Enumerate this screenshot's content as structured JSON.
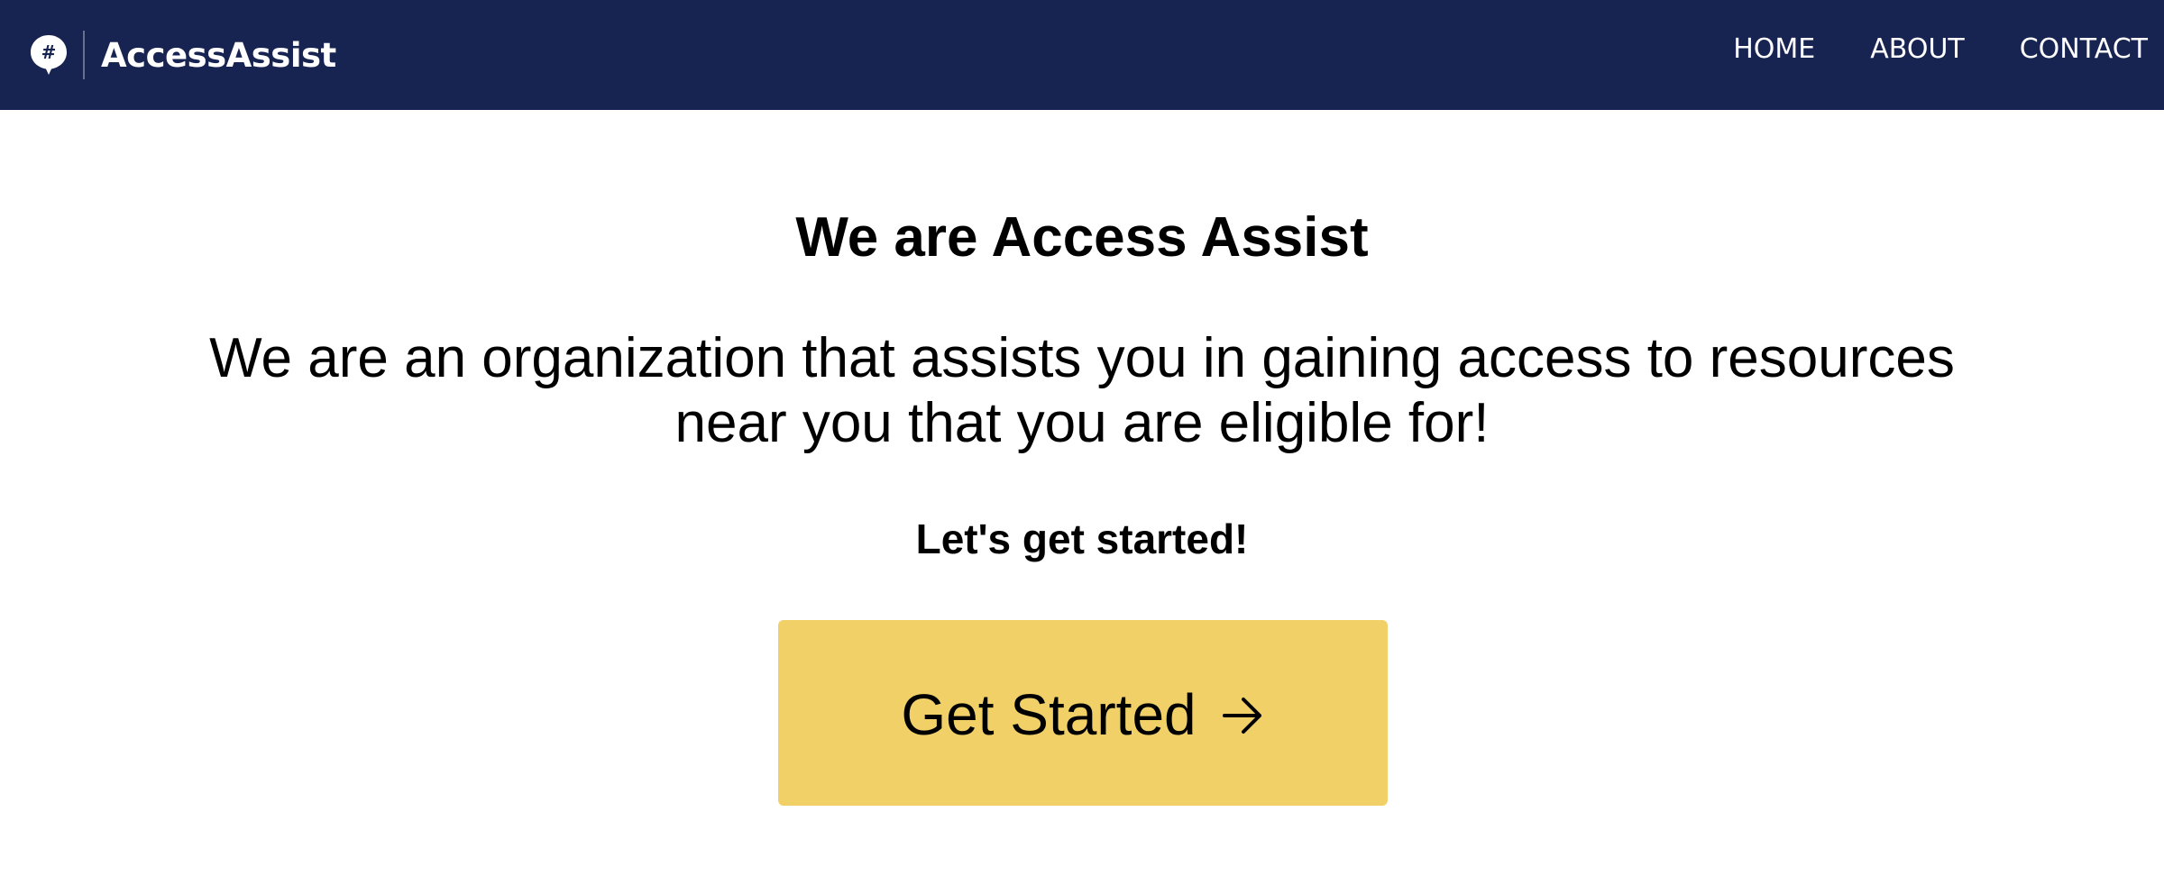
{
  "header": {
    "brand_name": "AccessAssist",
    "logo_icon": "hashtag-speech-bubble-icon",
    "logo_symbol": "#",
    "nav": [
      {
        "label": "HOME"
      },
      {
        "label": "ABOUT"
      },
      {
        "label": "CONTACT"
      }
    ]
  },
  "hero": {
    "title": "We are Access Assist",
    "description": "We are an organization that assists you in gaining access to resources near you that you are eligible for!",
    "cta_text": "Let's get started!",
    "button_label": "Get Started",
    "button_icon": "arrow-right-icon"
  },
  "colors": {
    "navbar_bg": "#172451",
    "button_bg": "#f0d067",
    "text": "#000000",
    "nav_text": "#ffffff"
  }
}
